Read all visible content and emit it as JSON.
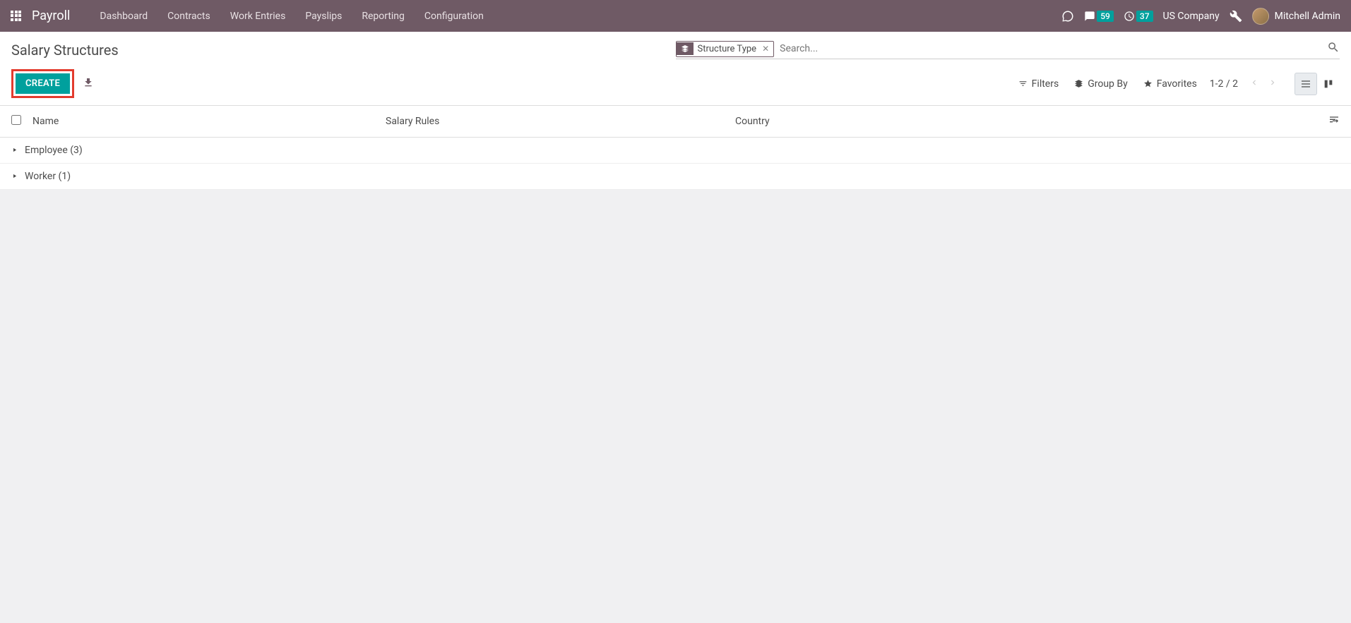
{
  "navbar": {
    "app_name": "Payroll",
    "items": [
      "Dashboard",
      "Contracts",
      "Work Entries",
      "Payslips",
      "Reporting",
      "Configuration"
    ],
    "messages_badge": "59",
    "clock_badge": "37",
    "company": "US Company",
    "user": "Mitchell Admin"
  },
  "control": {
    "page_title": "Salary Structures",
    "filter_chip": "Structure Type",
    "search_placeholder": "Search...",
    "create_label": "CREATE",
    "filters_label": "Filters",
    "groupby_label": "Group By",
    "favorites_label": "Favorites",
    "pager": "1-2 / 2"
  },
  "table": {
    "headers": {
      "name": "Name",
      "rules": "Salary Rules",
      "country": "Country"
    },
    "groups": [
      {
        "label": "Employee (3)"
      },
      {
        "label": "Worker (1)"
      }
    ]
  }
}
